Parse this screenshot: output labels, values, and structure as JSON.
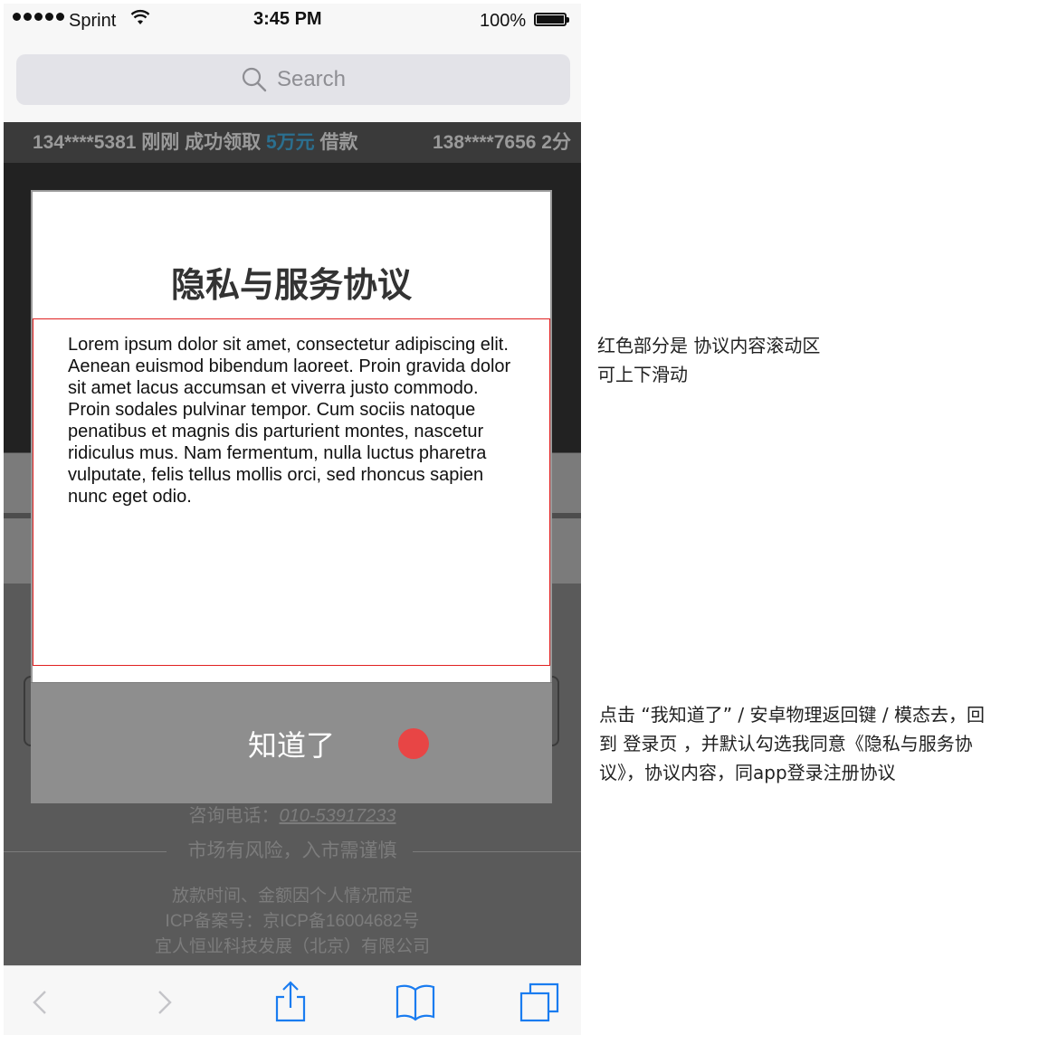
{
  "status_bar": {
    "carrier": "Sprint",
    "time": "3:45 PM",
    "battery": "100%"
  },
  "search_bar": {
    "placeholder": "Search"
  },
  "ticker": {
    "item1_prefix": "134****5381 刚刚 成功领取 ",
    "item1_amount": "5万元",
    "item1_suffix": " 借款",
    "item2": "138****7656  2分"
  },
  "modal": {
    "title": "隐私与服务协议",
    "body": "Lorem ipsum dolor sit amet, consectetur adipiscing elit. Aenean euismod bibendum laoreet. Proin gravida dolor sit amet lacus accumsan et viverra justo commodo. Proin sodales pulvinar tempor. Cum sociis natoque penatibus et magnis dis parturient montes, nascetur ridiculus mus. Nam fermentum, nulla luctus pharetra vulputate, felis tellus mollis orci, sed rhoncus sapien nunc eget odio.",
    "confirm_label": "知道了"
  },
  "footer": {
    "phone_label": "咨询电话：",
    "phone_number": "010-53917233",
    "risk": "市场有风险，入市需谨慎",
    "line1": "放款时间、金额因个人情况而定",
    "line2": "ICP备案号：京ICP备16004682号",
    "line3": "宜人恒业科技发展（北京）有限公司"
  },
  "annotations": {
    "note1_line1": "红色部分是 协议内容滚动区",
    "note1_line2": "可上下滑动",
    "note2_line1": "点击 “我知道了” / 安卓物理返回键 / 模态去，回",
    "note2_line2": "到 登录页 ，并默认勾选我同意《隐私与服务协",
    "note2_line3": "议》，协议内容，同app登录注册协议"
  },
  "colors": {
    "scroll_area_border": "#e02020",
    "red_dot": "#e84545",
    "ios_blue": "#1a7cf0",
    "ticker_amount": "#2b6f8f"
  },
  "icons": [
    "wifi-icon",
    "battery-icon",
    "search-icon",
    "back-icon",
    "forward-icon",
    "share-icon",
    "bookmarks-icon",
    "tabs-icon"
  ]
}
